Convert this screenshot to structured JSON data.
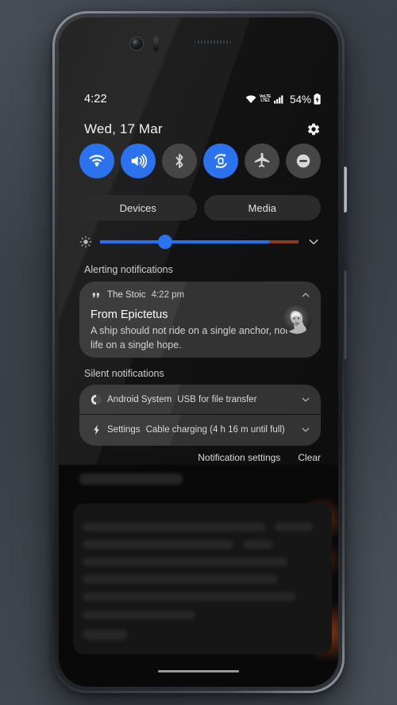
{
  "device": {
    "hardware": {
      "front_camera": "front-camera",
      "proximity_sensor": "proximity-sensor",
      "earpiece": "earpiece-speaker",
      "power_button": "power-button",
      "volume_button": "volume-button",
      "home_indicator": "home-gesture-bar"
    }
  },
  "status_bar": {
    "time": "4:22",
    "wifi_icon": "wifi-icon",
    "volte_top": "VoLTE",
    "volte_label_top": "VoLTE",
    "volte_line1": "VoLTE",
    "volte_line2": "LTE1",
    "signal_icon": "cellular-signal-icon",
    "battery_percent": "54%",
    "battery_icon": "battery-charging-icon"
  },
  "date_row": {
    "date": "Wed, 17 Mar",
    "settings_icon": "gear-icon"
  },
  "quick_settings": {
    "tiles": [
      {
        "name": "wifi",
        "icon": "wifi-icon",
        "state": "on"
      },
      {
        "name": "sound",
        "icon": "volume-up-icon",
        "state": "on"
      },
      {
        "name": "bluetooth",
        "icon": "bluetooth-icon",
        "state": "off"
      },
      {
        "name": "auto-rotate",
        "icon": "auto-rotate-icon",
        "state": "on"
      },
      {
        "name": "airplane",
        "icon": "airplane-icon",
        "state": "off"
      },
      {
        "name": "dnd",
        "icon": "do-not-disturb-icon",
        "state": "off"
      }
    ],
    "accent_on_color": "#2a72ee",
    "off_color": "#464646"
  },
  "shade_chips": {
    "devices_label": "Devices",
    "media_label": "Media"
  },
  "brightness": {
    "icon": "brightness-low-icon",
    "value_percent": 29,
    "expand_icon": "chevron-down-icon",
    "fill_color": "#2a6ee8",
    "warm_color": "#8a3a1d"
  },
  "sections": {
    "alerting_label": "Alerting notifications",
    "silent_label": "Silent notifications"
  },
  "notifications": {
    "stoic": {
      "app_icon": "quote-marks-icon",
      "app_name": "The Stoic",
      "time": "4:22 pm",
      "collapse_icon": "chevron-up-icon",
      "title": "From Epictetus",
      "body": "A ship should not ride on a single anchor, nor life on a single hope.",
      "avatar": "epictetus-bust-avatar"
    },
    "android_system": {
      "app_icon": "android-system-icon",
      "app_name": "Android System",
      "summary": "USB for file transfer",
      "expand_icon": "chevron-down-icon"
    },
    "settings": {
      "app_icon": "charging-bolt-icon",
      "app_name": "Settings",
      "summary": "Cable charging (4 h 16 m until full)",
      "expand_icon": "chevron-down-icon"
    }
  },
  "shade_actions": {
    "notification_settings_label": "Notification settings",
    "clear_label": "Clear"
  }
}
